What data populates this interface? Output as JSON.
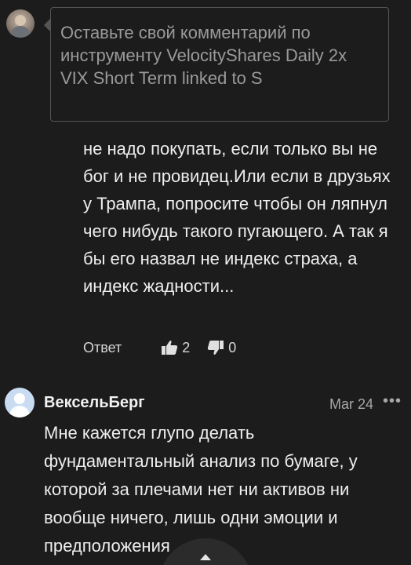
{
  "comment_input": {
    "placeholder": "Оставьте свой комментарий по инструменту VelocityShares Daily 2x VIX Short Term linked to S"
  },
  "reply": {
    "text": "не надо покупать, если только вы не бог и не провидец.Или если в друзьях у Трампа, попросите чтобы он ляпнул чего нибудь такого пугающего. А так я бы его назвал не индекс страха, а индекс жадности...",
    "reply_label": "Ответ",
    "likes": "2",
    "dislikes": "0"
  },
  "post": {
    "username": "ВексельБерг",
    "date": "Mar 24",
    "more_label": "•••",
    "text": "Мне кажется глупо делать фундаментальный анализ по бумаге, у которой за плечами нет ни активов ни вообще ничего, лишь одни эмоции и предположения"
  },
  "icons": {
    "like": "thumbs-up-icon",
    "dislike": "thumbs-down-icon",
    "scroll": "chevron-up-icon"
  }
}
